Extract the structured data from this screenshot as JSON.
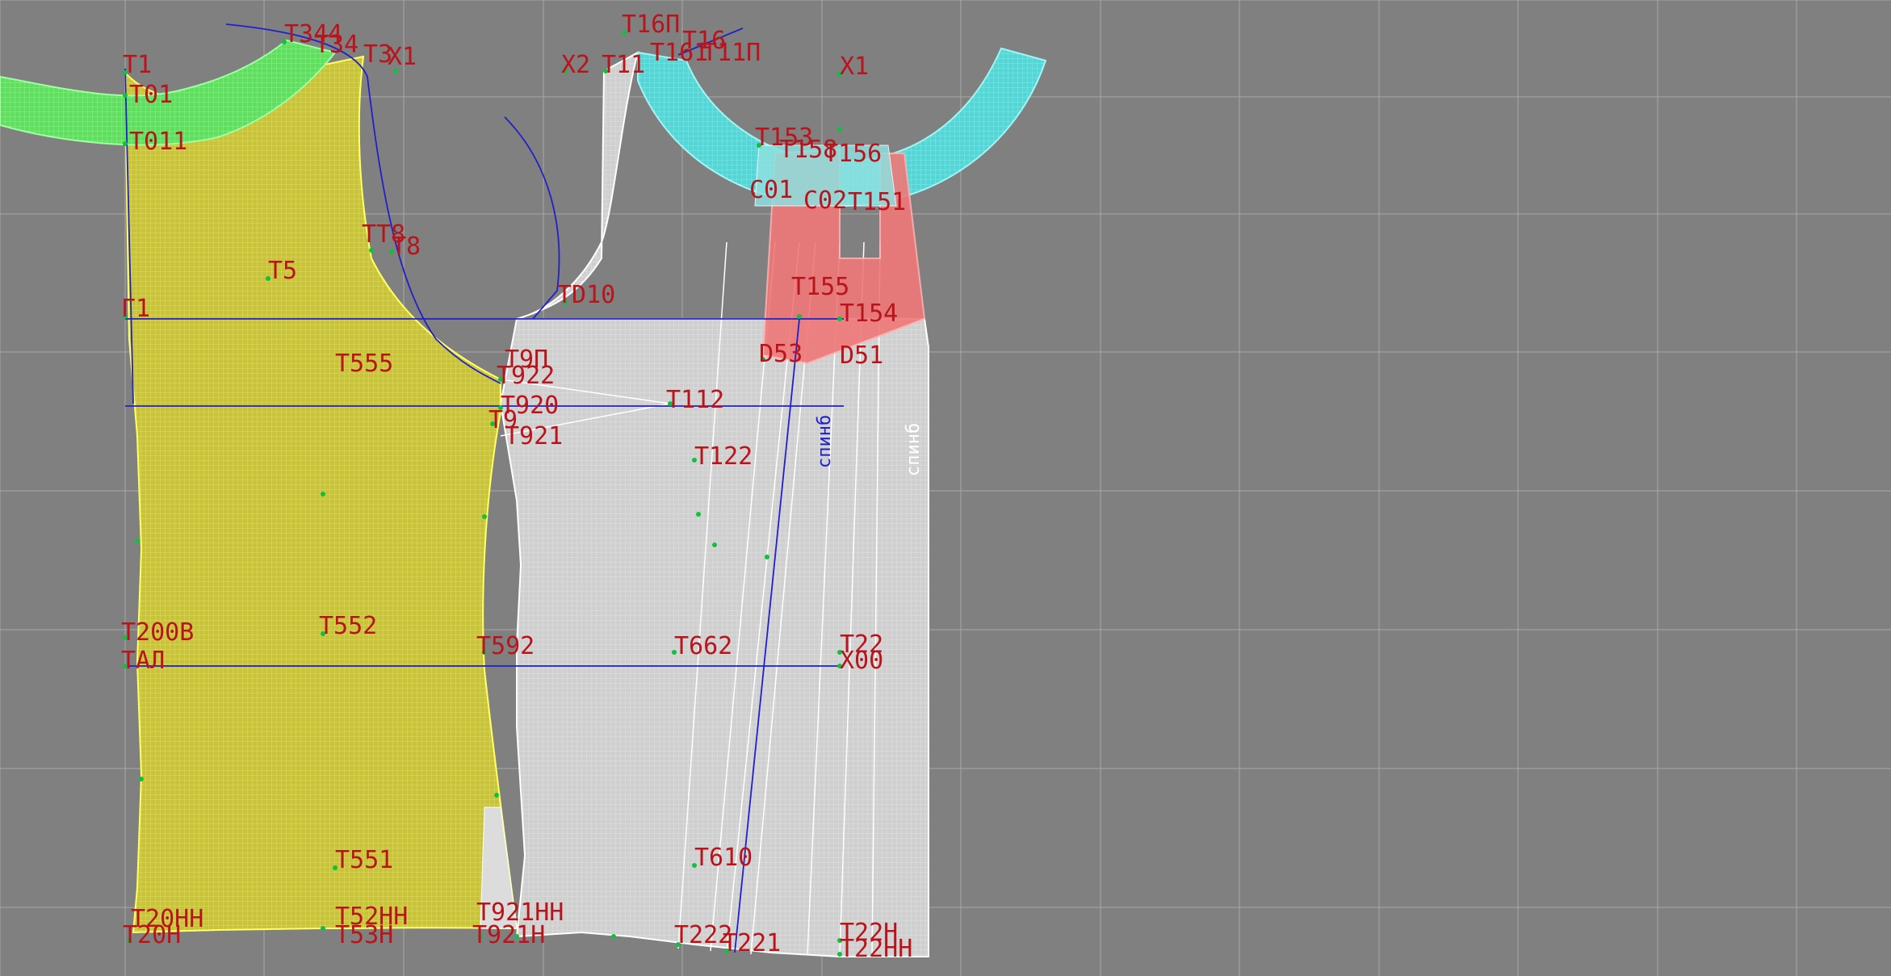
{
  "colors": {
    "background": "#808080",
    "grid": "#a6a6a6",
    "label": "#b8141c",
    "construction_line": "#2020c8",
    "front_piece": "#c9c436",
    "back_piece": "#c8c8c8",
    "collar_front": "#5ee05e",
    "collar_back": "#52d6d6",
    "pocket": "#f07878",
    "point": "#10c040"
  },
  "labels": {
    "t1": "T1",
    "t01": "T01",
    "t011": "T011",
    "t344": "T344",
    "t34": "T34",
    "t3": "T3",
    "x1l": "X1",
    "x2": "X2",
    "t11": "T11",
    "t16p": "T16П",
    "t161": "T161",
    "t16": "T16",
    "t11p": "T11П",
    "x1r": "X1",
    "t153": "T153",
    "t158": "T158",
    "t156": "T156",
    "c01": "C01",
    "c02": "C02",
    "t151": "T151",
    "tt8": "TT8",
    "t8": "T8",
    "t5": "T5",
    "g1": "Г1",
    "td10": "TD10",
    "t155": "T155",
    "t154": "T154",
    "t9p": "T9П",
    "t922": "T922",
    "t555": "T555",
    "d53": "D53",
    "d51": "D51",
    "t920": "T920",
    "t9": "T9",
    "t921": "T921",
    "t112": "T112",
    "t122": "T122",
    "t200b": "T200B",
    "tal": "TAЛ",
    "t552": "T552",
    "t592": "T592",
    "t662": "T662",
    "t22": "T22",
    "x00": "X00",
    "t551": "T551",
    "t610": "T610",
    "t20nn": "T20HH",
    "t20n": "T20H",
    "t52nn": "T52HH",
    "t53n": "T53H",
    "t921nn": "T921HH",
    "t921n": "T921H",
    "t222": "T222",
    "t221": "T221",
    "t22n": "T22H",
    "t22nn": "T22HH"
  },
  "vertical_text": {
    "spinka_left": "спинб",
    "spinka_right": "спинб"
  }
}
